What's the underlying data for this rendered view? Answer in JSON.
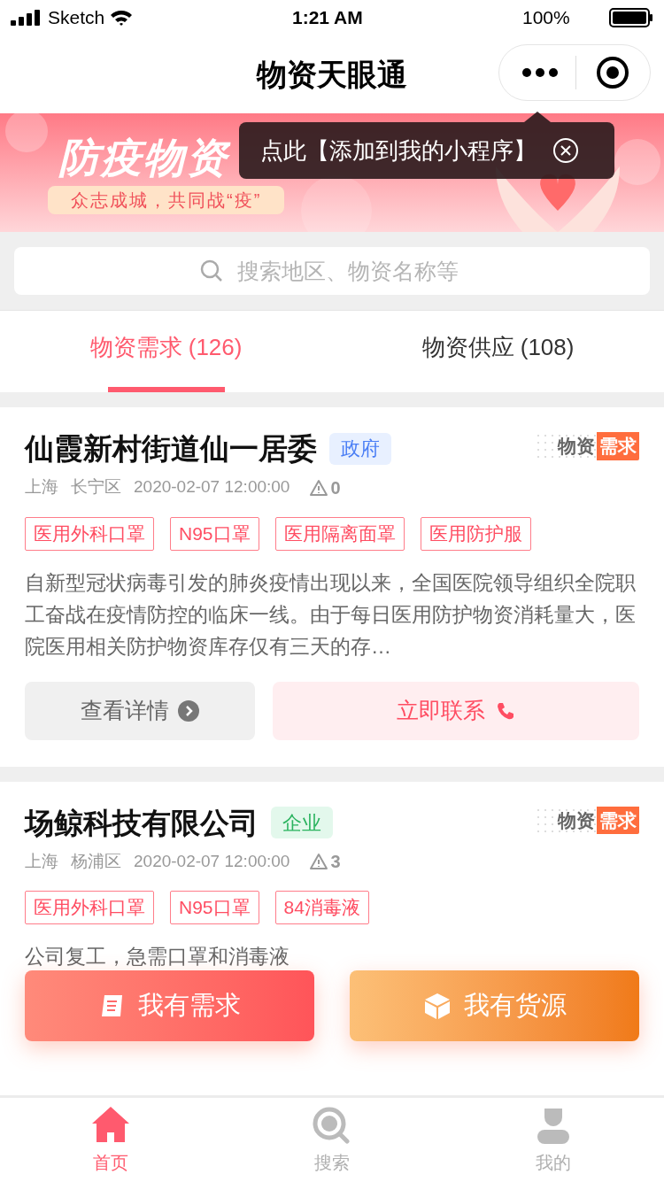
{
  "status_bar": {
    "carrier": "Sketch",
    "time": "1:21 AM",
    "battery": "100%"
  },
  "nav": {
    "title": "物资天眼通"
  },
  "banner": {
    "title": "防疫物资",
    "slogan": "众志成城，共同战“疫”"
  },
  "tooltip": {
    "text": "点此【添加到我的小程序】"
  },
  "search": {
    "placeholder": "搜索地区、物资名称等"
  },
  "tabs": [
    {
      "label": "物资需求",
      "count": "(126)",
      "selected": true
    },
    {
      "label": "物资供应",
      "count": "(108)",
      "selected": false
    }
  ],
  "cards": [
    {
      "name": "仙霞新村街道仙一居委",
      "org_type": "政府",
      "kind": "gov",
      "badge_a": "物资",
      "badge_b": "需求",
      "city": "上海",
      "district": "长宁区",
      "time": "2020-02-07 12:00:00",
      "reports": "0",
      "tags": [
        "医用外科口罩",
        "N95口罩",
        "医用隔离面罩",
        "医用防护服"
      ],
      "description": "自新型冠状病毒引发的肺炎疫情出现以来，全国医院领导组织全院职工奋战在疫情防控的临床一线。由于每日医用防护物资消耗量大，医院医用相关防护物资库存仅有三天的存…",
      "buttons": [
        "查看详情",
        "立即联系"
      ]
    },
    {
      "name": "场鲸科技有限公司",
      "org_type": "企业",
      "kind": "company",
      "badge_a": "物资",
      "badge_b": "需求",
      "city": "上海",
      "district": "杨浦区",
      "time": "2020-02-07 12:00:00",
      "reports": "3",
      "tags": [
        "医用外科口罩",
        "N95口罩",
        "84消毒液"
      ],
      "description": "公司复工，急需口罩和消毒液"
    }
  ],
  "floating_buttons": [
    {
      "label": "我有需求",
      "kind": "demand"
    },
    {
      "label": "我有货源",
      "kind": "supply"
    }
  ],
  "bottom_tabs": [
    {
      "label": "首页",
      "kind": "home",
      "selected": true
    },
    {
      "label": "搜索",
      "kind": "search",
      "selected": false
    },
    {
      "label": "我的",
      "kind": "me",
      "selected": false
    }
  ]
}
